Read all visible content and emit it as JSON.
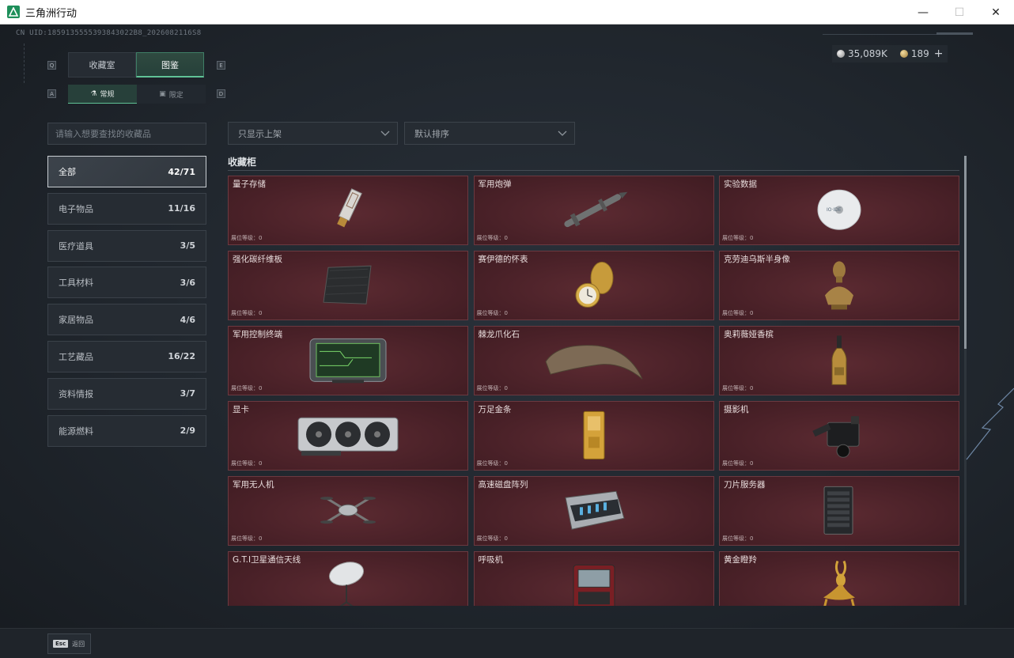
{
  "window": {
    "title": "三角洲行动",
    "minimize": "—",
    "maximize": "☐",
    "close": "✕"
  },
  "uid": "CN UID:1859135555393843022B8_2026082116S8",
  "currency": {
    "silver": "35,089K",
    "gold": "189",
    "add": "+"
  },
  "keys": {
    "q": "Q",
    "e": "E",
    "a": "A",
    "d": "D"
  },
  "tabs": [
    {
      "label": "收藏室",
      "active": false
    },
    {
      "label": "图鉴",
      "active": true
    }
  ],
  "subtabs": [
    {
      "label": "常规",
      "active": true
    },
    {
      "label": "限定",
      "active": false
    }
  ],
  "search": {
    "placeholder": "请输入想要查找的收藏品"
  },
  "categories": [
    {
      "label": "全部",
      "count": "42/71",
      "active": true
    },
    {
      "label": "电子物品",
      "count": "11/16"
    },
    {
      "label": "医疗道具",
      "count": "3/5"
    },
    {
      "label": "工具材料",
      "count": "3/6"
    },
    {
      "label": "家居物品",
      "count": "4/6"
    },
    {
      "label": "工艺藏品",
      "count": "16/22"
    },
    {
      "label": "资料情报",
      "count": "3/7"
    },
    {
      "label": "能源燃料",
      "count": "2/9"
    }
  ],
  "filters": {
    "shelf": "只显示上架",
    "sort": "默认排序"
  },
  "cabinet": {
    "title": "收藏柜",
    "items": [
      {
        "name": "量子存储",
        "level": "展位等级：0",
        "icon": "usb-drive-icon"
      },
      {
        "name": "军用炮弹",
        "level": "展位等级：0",
        "icon": "missile-icon"
      },
      {
        "name": "实验数据",
        "level": "展位等级：0",
        "icon": "disc-icon"
      },
      {
        "name": "强化碳纤维板",
        "level": "展位等级：0",
        "icon": "carbon-plate-icon"
      },
      {
        "name": "赛伊德的怀表",
        "level": "展位等级：0",
        "icon": "pocket-watch-icon"
      },
      {
        "name": "克劳迪乌斯半身像",
        "level": "展位等级：0",
        "icon": "bust-icon"
      },
      {
        "name": "军用控制终端",
        "level": "展位等级：0",
        "icon": "terminal-icon"
      },
      {
        "name": "棘龙爪化石",
        "level": "展位等级：0",
        "icon": "claw-fossil-icon"
      },
      {
        "name": "奥莉薇娅香槟",
        "level": "展位等级：0",
        "icon": "champagne-icon"
      },
      {
        "name": "显卡",
        "level": "展位等级：0",
        "icon": "gpu-icon"
      },
      {
        "name": "万足金条",
        "level": "展位等级：0",
        "icon": "gold-bar-icon"
      },
      {
        "name": "摄影机",
        "level": "展位等级：0",
        "icon": "camera-icon"
      },
      {
        "name": "军用无人机",
        "level": "展位等级：0",
        "icon": "drone-icon"
      },
      {
        "name": "高速磁盘阵列",
        "level": "展位等级：0",
        "icon": "disk-array-icon"
      },
      {
        "name": "刀片服务器",
        "level": "展位等级：0",
        "icon": "server-icon"
      },
      {
        "name": "G.T.I卫星通信天线",
        "level": "",
        "icon": "satellite-dish-icon"
      },
      {
        "name": "呼吸机",
        "level": "",
        "icon": "ventilator-icon"
      },
      {
        "name": "黄金瞪羚",
        "level": "",
        "icon": "gazelle-icon"
      }
    ]
  },
  "bottom": {
    "esc": "Esc",
    "back": "返回"
  },
  "colors": {
    "accent": "#60c296",
    "card_bg": "#4a2128",
    "panel": "#262c33"
  }
}
